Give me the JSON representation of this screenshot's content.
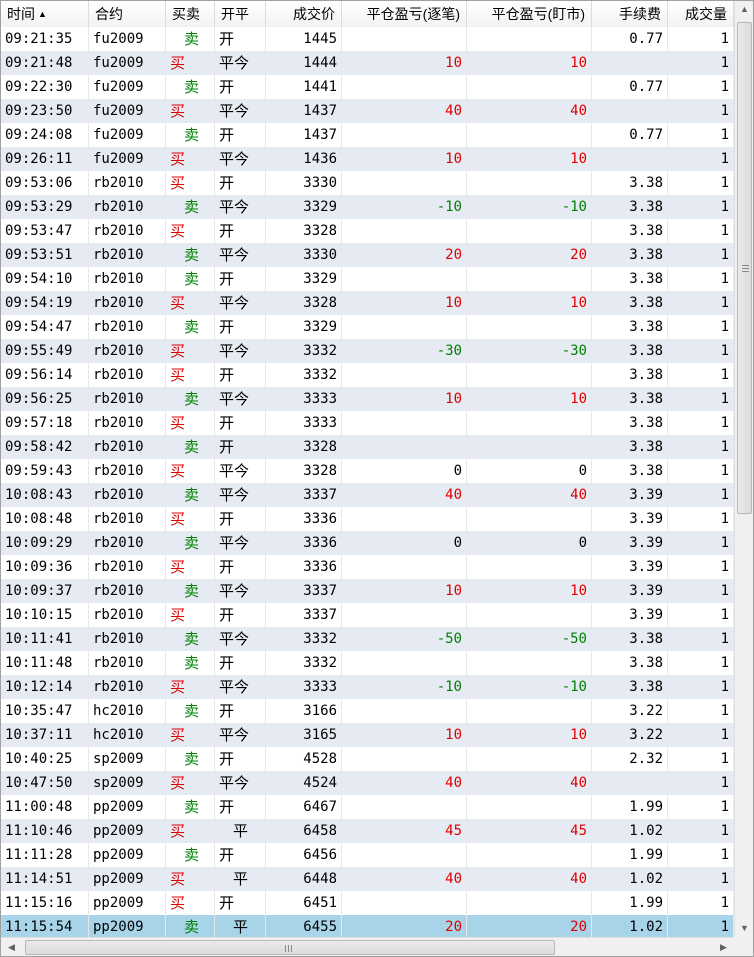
{
  "columns": {
    "time": "时间",
    "contract": "合约",
    "side": "买卖",
    "open_close": "开平",
    "price": "成交价",
    "pnl_trade": "平仓盈亏(逐笔)",
    "pnl_mtm": "平仓盈亏(盯市)",
    "fee": "手续费",
    "volume": "成交量"
  },
  "sort_indicator": "▲",
  "rows": [
    {
      "time": "09:21:35",
      "contract": "fu2009",
      "side": "卖",
      "oc": "开",
      "price": "1445",
      "pnl_trade": "",
      "pnl_mtm": "",
      "fee": "0.77",
      "vol": "1"
    },
    {
      "time": "09:21:48",
      "contract": "fu2009",
      "side": "买",
      "oc": "平今",
      "price": "1444",
      "pnl_trade": "10",
      "pnl_mtm": "10",
      "fee": "",
      "vol": "1"
    },
    {
      "time": "09:22:30",
      "contract": "fu2009",
      "side": "卖",
      "oc": "开",
      "price": "1441",
      "pnl_trade": "",
      "pnl_mtm": "",
      "fee": "0.77",
      "vol": "1"
    },
    {
      "time": "09:23:50",
      "contract": "fu2009",
      "side": "买",
      "oc": "平今",
      "price": "1437",
      "pnl_trade": "40",
      "pnl_mtm": "40",
      "fee": "",
      "vol": "1"
    },
    {
      "time": "09:24:08",
      "contract": "fu2009",
      "side": "卖",
      "oc": "开",
      "price": "1437",
      "pnl_trade": "",
      "pnl_mtm": "",
      "fee": "0.77",
      "vol": "1"
    },
    {
      "time": "09:26:11",
      "contract": "fu2009",
      "side": "买",
      "oc": "平今",
      "price": "1436",
      "pnl_trade": "10",
      "pnl_mtm": "10",
      "fee": "",
      "vol": "1"
    },
    {
      "time": "09:53:06",
      "contract": "rb2010",
      "side": "买",
      "oc": "开",
      "price": "3330",
      "pnl_trade": "",
      "pnl_mtm": "",
      "fee": "3.38",
      "vol": "1"
    },
    {
      "time": "09:53:29",
      "contract": "rb2010",
      "side": "卖",
      "oc": "平今",
      "price": "3329",
      "pnl_trade": "-10",
      "pnl_mtm": "-10",
      "fee": "3.38",
      "vol": "1"
    },
    {
      "time": "09:53:47",
      "contract": "rb2010",
      "side": "买",
      "oc": "开",
      "price": "3328",
      "pnl_trade": "",
      "pnl_mtm": "",
      "fee": "3.38",
      "vol": "1"
    },
    {
      "time": "09:53:51",
      "contract": "rb2010",
      "side": "卖",
      "oc": "平今",
      "price": "3330",
      "pnl_trade": "20",
      "pnl_mtm": "20",
      "fee": "3.38",
      "vol": "1"
    },
    {
      "time": "09:54:10",
      "contract": "rb2010",
      "side": "卖",
      "oc": "开",
      "price": "3329",
      "pnl_trade": "",
      "pnl_mtm": "",
      "fee": "3.38",
      "vol": "1"
    },
    {
      "time": "09:54:19",
      "contract": "rb2010",
      "side": "买",
      "oc": "平今",
      "price": "3328",
      "pnl_trade": "10",
      "pnl_mtm": "10",
      "fee": "3.38",
      "vol": "1"
    },
    {
      "time": "09:54:47",
      "contract": "rb2010",
      "side": "卖",
      "oc": "开",
      "price": "3329",
      "pnl_trade": "",
      "pnl_mtm": "",
      "fee": "3.38",
      "vol": "1"
    },
    {
      "time": "09:55:49",
      "contract": "rb2010",
      "side": "买",
      "oc": "平今",
      "price": "3332",
      "pnl_trade": "-30",
      "pnl_mtm": "-30",
      "fee": "3.38",
      "vol": "1"
    },
    {
      "time": "09:56:14",
      "contract": "rb2010",
      "side": "买",
      "oc": "开",
      "price": "3332",
      "pnl_trade": "",
      "pnl_mtm": "",
      "fee": "3.38",
      "vol": "1"
    },
    {
      "time": "09:56:25",
      "contract": "rb2010",
      "side": "卖",
      "oc": "平今",
      "price": "3333",
      "pnl_trade": "10",
      "pnl_mtm": "10",
      "fee": "3.38",
      "vol": "1"
    },
    {
      "time": "09:57:18",
      "contract": "rb2010",
      "side": "买",
      "oc": "开",
      "price": "3333",
      "pnl_trade": "",
      "pnl_mtm": "",
      "fee": "3.38",
      "vol": "1"
    },
    {
      "time": "09:58:42",
      "contract": "rb2010",
      "side": "卖",
      "oc": "开",
      "price": "3328",
      "pnl_trade": "",
      "pnl_mtm": "",
      "fee": "3.38",
      "vol": "1"
    },
    {
      "time": "09:59:43",
      "contract": "rb2010",
      "side": "买",
      "oc": "平今",
      "price": "3328",
      "pnl_trade": "0",
      "pnl_mtm": "0",
      "fee": "3.38",
      "vol": "1"
    },
    {
      "time": "10:08:43",
      "contract": "rb2010",
      "side": "卖",
      "oc": "平今",
      "price": "3337",
      "pnl_trade": "40",
      "pnl_mtm": "40",
      "fee": "3.39",
      "vol": "1"
    },
    {
      "time": "10:08:48",
      "contract": "rb2010",
      "side": "买",
      "oc": "开",
      "price": "3336",
      "pnl_trade": "",
      "pnl_mtm": "",
      "fee": "3.39",
      "vol": "1"
    },
    {
      "time": "10:09:29",
      "contract": "rb2010",
      "side": "卖",
      "oc": "平今",
      "price": "3336",
      "pnl_trade": "0",
      "pnl_mtm": "0",
      "fee": "3.39",
      "vol": "1"
    },
    {
      "time": "10:09:36",
      "contract": "rb2010",
      "side": "买",
      "oc": "开",
      "price": "3336",
      "pnl_trade": "",
      "pnl_mtm": "",
      "fee": "3.39",
      "vol": "1"
    },
    {
      "time": "10:09:37",
      "contract": "rb2010",
      "side": "卖",
      "oc": "平今",
      "price": "3337",
      "pnl_trade": "10",
      "pnl_mtm": "10",
      "fee": "3.39",
      "vol": "1"
    },
    {
      "time": "10:10:15",
      "contract": "rb2010",
      "side": "买",
      "oc": "开",
      "price": "3337",
      "pnl_trade": "",
      "pnl_mtm": "",
      "fee": "3.39",
      "vol": "1"
    },
    {
      "time": "10:11:41",
      "contract": "rb2010",
      "side": "卖",
      "oc": "平今",
      "price": "3332",
      "pnl_trade": "-50",
      "pnl_mtm": "-50",
      "fee": "3.38",
      "vol": "1"
    },
    {
      "time": "10:11:48",
      "contract": "rb2010",
      "side": "卖",
      "oc": "开",
      "price": "3332",
      "pnl_trade": "",
      "pnl_mtm": "",
      "fee": "3.38",
      "vol": "1"
    },
    {
      "time": "10:12:14",
      "contract": "rb2010",
      "side": "买",
      "oc": "平今",
      "price": "3333",
      "pnl_trade": "-10",
      "pnl_mtm": "-10",
      "fee": "3.38",
      "vol": "1"
    },
    {
      "time": "10:35:47",
      "contract": "hc2010",
      "side": "卖",
      "oc": "开",
      "price": "3166",
      "pnl_trade": "",
      "pnl_mtm": "",
      "fee": "3.22",
      "vol": "1"
    },
    {
      "time": "10:37:11",
      "contract": "hc2010",
      "side": "买",
      "oc": "平今",
      "price": "3165",
      "pnl_trade": "10",
      "pnl_mtm": "10",
      "fee": "3.22",
      "vol": "1"
    },
    {
      "time": "10:40:25",
      "contract": "sp2009",
      "side": "卖",
      "oc": "开",
      "price": "4528",
      "pnl_trade": "",
      "pnl_mtm": "",
      "fee": "2.32",
      "vol": "1"
    },
    {
      "time": "10:47:50",
      "contract": "sp2009",
      "side": "买",
      "oc": "平今",
      "price": "4524",
      "pnl_trade": "40",
      "pnl_mtm": "40",
      "fee": "",
      "vol": "1"
    },
    {
      "time": "11:00:48",
      "contract": "pp2009",
      "side": "卖",
      "oc": "开",
      "price": "6467",
      "pnl_trade": "",
      "pnl_mtm": "",
      "fee": "1.99",
      "vol": "1"
    },
    {
      "time": "11:10:46",
      "contract": "pp2009",
      "side": "买",
      "oc": "平",
      "price": "6458",
      "pnl_trade": "45",
      "pnl_mtm": "45",
      "fee": "1.02",
      "vol": "1"
    },
    {
      "time": "11:11:28",
      "contract": "pp2009",
      "side": "卖",
      "oc": "开",
      "price": "6456",
      "pnl_trade": "",
      "pnl_mtm": "",
      "fee": "1.99",
      "vol": "1"
    },
    {
      "time": "11:14:51",
      "contract": "pp2009",
      "side": "买",
      "oc": "平",
      "price": "6448",
      "pnl_trade": "40",
      "pnl_mtm": "40",
      "fee": "1.02",
      "vol": "1"
    },
    {
      "time": "11:15:16",
      "contract": "pp2009",
      "side": "买",
      "oc": "开",
      "price": "6451",
      "pnl_trade": "",
      "pnl_mtm": "",
      "fee": "1.99",
      "vol": "1"
    },
    {
      "time": "11:15:54",
      "contract": "pp2009",
      "side": "卖",
      "oc": "平",
      "price": "6455",
      "pnl_trade": "20",
      "pnl_mtm": "20",
      "fee": "1.02",
      "vol": "1"
    }
  ],
  "selected_row": 37,
  "colors": {
    "buy": "#e00000",
    "sell": "#008000",
    "profit": "#e00000",
    "loss": "#008000",
    "row_alt": "#e6eaf2",
    "row_selected": "#a8d4ea"
  }
}
